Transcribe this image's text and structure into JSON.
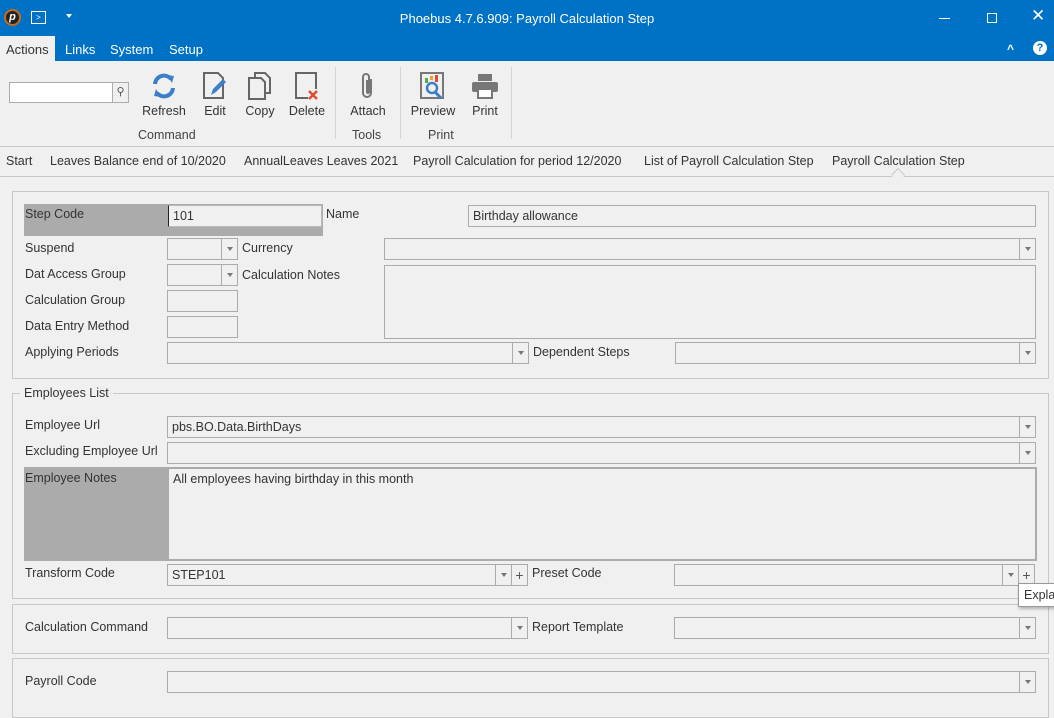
{
  "window": {
    "title": "Phoebus 4.7.6.909: Payroll Calculation Step"
  },
  "menu": {
    "tabs": [
      "Actions",
      "Links",
      "System",
      "Setup"
    ],
    "active": "Actions"
  },
  "ribbon": {
    "search": {
      "value": "",
      "placeholder": ""
    },
    "buttons": {
      "refresh": "Refresh",
      "edit": "Edit",
      "copy": "Copy",
      "delete": "Delete",
      "attach": "Attach",
      "preview": "Preview",
      "print": "Print"
    },
    "groups": {
      "command": "Command",
      "tools": "Tools",
      "print": "Print"
    }
  },
  "breadcrumb": [
    "Start",
    "Leaves Balance end of 10/2020",
    "AnnualLeaves Leaves 2021",
    "Payroll Calculation for period 12/2020",
    "List of Payroll Calculation Step",
    "Payroll Calculation Step"
  ],
  "form": {
    "step_code": {
      "label": "Step Code",
      "value": "101"
    },
    "name": {
      "label": "Name",
      "value": "Birthday allowance"
    },
    "suspend": {
      "label": "Suspend",
      "value": ""
    },
    "currency": {
      "label": "Currency",
      "value": ""
    },
    "dat_access_group": {
      "label": "Dat Access Group",
      "value": ""
    },
    "calculation_notes": {
      "label": "Calculation Notes",
      "value": ""
    },
    "calculation_group": {
      "label": "Calculation Group",
      "value": ""
    },
    "data_entry_method": {
      "label": "Data Entry Method",
      "value": ""
    },
    "applying_periods": {
      "label": "Applying Periods",
      "value": ""
    },
    "dependent_steps": {
      "label": "Dependent Steps",
      "value": ""
    }
  },
  "employees": {
    "legend": "Employees List",
    "employee_url": {
      "label": "Employee Url",
      "value": "pbs.BO.Data.BirthDays"
    },
    "excluding_employee_url": {
      "label": "Excluding Employee Url",
      "value": ""
    },
    "employee_notes": {
      "label": "Employee Notes",
      "value": "All employees having birthday in this month"
    },
    "transform_code": {
      "label": "Transform Code",
      "value": "STEP101"
    },
    "preset_code": {
      "label": "Preset Code",
      "value": ""
    }
  },
  "tooltip": "Expla",
  "calc": {
    "calculation_command": {
      "label": "Calculation Command",
      "value": ""
    },
    "report_template": {
      "label": "Report Template",
      "value": ""
    }
  },
  "payroll": {
    "payroll_code": {
      "label": "Payroll Code",
      "value": ""
    }
  },
  "colors": {
    "accent": "#0072c6",
    "highlight": "#ababab"
  }
}
